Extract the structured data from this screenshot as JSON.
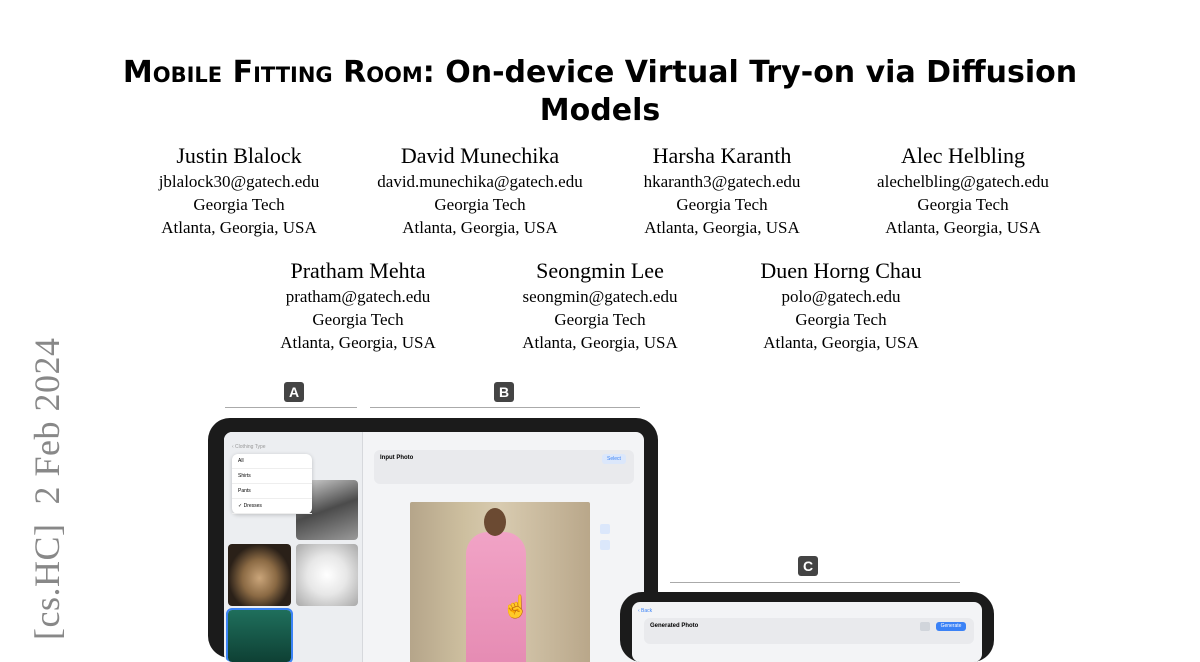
{
  "paper": {
    "title_sc1": "Mobile Fitting Room",
    "title_rest1": ": On-device Virtual Try-on via Diffusion",
    "title_line2": "Models",
    "arxiv_stamp": "[cs.HC]  2 Feb 2024"
  },
  "authors": [
    {
      "name": "Justin Blalock",
      "email": "jblalock30@gatech.edu",
      "affiliation": "Georgia Tech",
      "location": "Atlanta, Georgia, USA"
    },
    {
      "name": "David Munechika",
      "email": "david.munechika@gatech.edu",
      "affiliation": "Georgia Tech",
      "location": "Atlanta, Georgia, USA"
    },
    {
      "name": "Harsha Karanth",
      "email": "hkaranth3@gatech.edu",
      "affiliation": "Georgia Tech",
      "location": "Atlanta, Georgia, USA"
    },
    {
      "name": "Alec Helbling",
      "email": "alechelbling@gatech.edu",
      "affiliation": "Georgia Tech",
      "location": "Atlanta, Georgia, USA"
    },
    {
      "name": "Pratham Mehta",
      "email": "pratham@gatech.edu",
      "affiliation": "Georgia Tech",
      "location": "Atlanta, Georgia, USA"
    },
    {
      "name": "Seongmin Lee",
      "email": "seongmin@gatech.edu",
      "affiliation": "Georgia Tech",
      "location": "Atlanta, Georgia, USA"
    },
    {
      "name": "Duen Horng Chau",
      "email": "polo@gatech.edu",
      "affiliation": "Georgia Tech",
      "location": "Atlanta, Georgia, USA"
    }
  ],
  "figure": {
    "badges": [
      "A",
      "B",
      "C"
    ],
    "menu_items": [
      "All",
      "Shirts",
      "Pants",
      "✓ Dresses"
    ],
    "input_photo_title": "Input Photo",
    "select_btn": "Select",
    "generated_photo_title": "Generated Photo",
    "generate_btn": "Generate",
    "back_link": "‹ Back",
    "colors": {
      "accent": "#3b82f6",
      "device": "#1b1b1b",
      "dress_pink": "#ec8fb5"
    }
  }
}
